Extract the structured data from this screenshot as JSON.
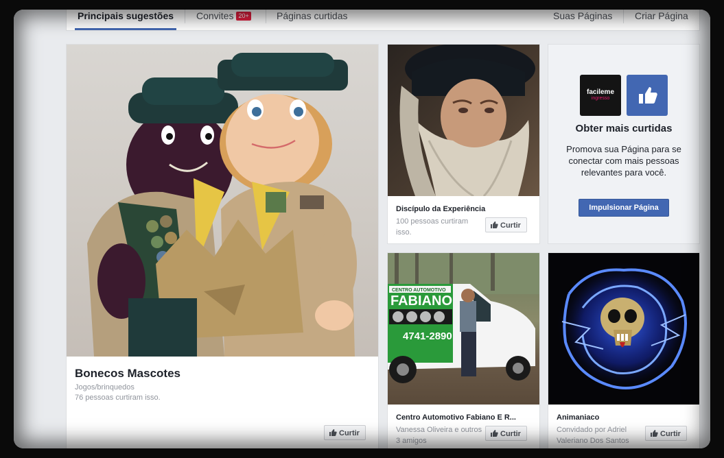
{
  "tabs": [
    {
      "label": "Principais sugestões",
      "active": true
    },
    {
      "label": "Convites",
      "badge": "20+"
    },
    {
      "label": "Páginas curtidas"
    }
  ],
  "right_links": [
    "Suas Páginas",
    "Criar Página"
  ],
  "like_label": "Curtir",
  "cards": {
    "main": {
      "name": "Bonecos Mascotes",
      "category": "Jogos/brinquedos",
      "likes": "76 pessoas curtiram isso."
    },
    "leo": {
      "name": "Discípulo da Experiência",
      "likes": "100 pessoas curtiram isso."
    },
    "fabiano": {
      "name": "Centro Automotivo Fabiano E R...",
      "friends": "Vanessa Oliveira e outros 3 amigos",
      "van_text": "FABIANO",
      "van_sub": "CENTRO AUTOMOTIVO",
      "van_phone": "4741-2890"
    },
    "anima": {
      "name": "Animaniaco",
      "invited": "Convidado por Adriel Valeriano Dos Santos"
    }
  },
  "promo": {
    "logo_line1": "facileme",
    "logo_line2": "ingresso",
    "title": "Obter mais curtidas",
    "text": "Promova sua Página para se conectar com mais pessoas relevantes para você.",
    "button": "Impulsionar Página"
  },
  "colors": {
    "accent": "#4267b2",
    "badge": "#e41e3f"
  }
}
